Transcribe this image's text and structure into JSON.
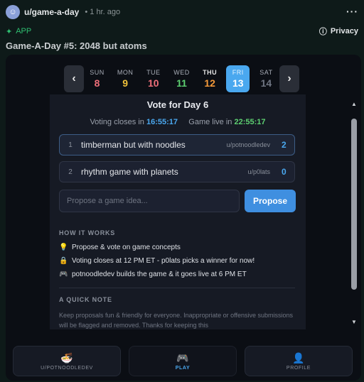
{
  "post": {
    "username": "u/game-a-day",
    "time": "• 1 hr. ago",
    "app_label": "APP",
    "privacy_label": "Privacy",
    "title": "Game-A-Day #5: 2048 but atoms"
  },
  "days": [
    {
      "name": "SUN",
      "date": "8",
      "color": "#ef6f7a"
    },
    {
      "name": "MON",
      "date": "9",
      "color": "#f0c23a"
    },
    {
      "name": "TUE",
      "date": "10",
      "color": "#ef6f7a"
    },
    {
      "name": "WED",
      "date": "11",
      "color": "#5dcf71"
    },
    {
      "name": "THU",
      "date": "12",
      "color": "#f59a3a"
    },
    {
      "name": "FRI",
      "date": "13",
      "color": "#ffffff"
    },
    {
      "name": "SAT",
      "date": "14",
      "color": "#6f7582"
    }
  ],
  "vote": {
    "title": "Vote for Day 6",
    "closes_label": "Voting closes in",
    "closes_time": "16:55:17",
    "live_label": "Game live in",
    "live_time": "22:55:17"
  },
  "ideas": [
    {
      "rank": "1",
      "title": "timberman but with noodles",
      "author": "u/potnoodledev",
      "votes": "2"
    },
    {
      "rank": "2",
      "title": "rhythm game with planets",
      "author": "u/p0lats",
      "votes": "0"
    }
  ],
  "propose": {
    "placeholder": "Propose a game idea...",
    "button": "Propose"
  },
  "how_it_works": {
    "heading": "HOW IT WORKS",
    "items": [
      {
        "icon": "lightbulb-icon",
        "text": "Propose & vote on game concepts"
      },
      {
        "icon": "lock-icon",
        "text": "Voting closes at 12 PM ET - p0lats picks a winner for now!"
      },
      {
        "icon": "gamepad-icon",
        "text": "potnoodledev builds the game & it goes live at 6 PM ET"
      }
    ]
  },
  "quick_note": {
    "heading": "A QUICK NOTE",
    "text": "Keep proposals fun & friendly for everyone. Inappropriate or offensive submissions will be flagged and removed. Thanks for keeping this"
  },
  "nav": [
    {
      "label": "U/POTNOODLEDEV",
      "icon": "noodle-cup-icon"
    },
    {
      "label": "PLAY",
      "icon": "gamepad-icon"
    },
    {
      "label": "PROFILE",
      "icon": "user-icon"
    }
  ],
  "colors": {
    "accent": "#4aa8ef",
    "green": "#5dcf71",
    "app_green": "#2fbf71"
  }
}
